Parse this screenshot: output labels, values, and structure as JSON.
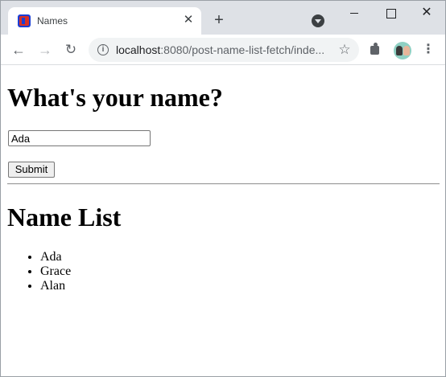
{
  "browser": {
    "tab_title": "Names",
    "tab_close": "✕",
    "new_tab": "+",
    "url_host": "localhost",
    "url_rest": ":8080/post-name-list-fetch/inde...",
    "icons": {
      "favicon": "app-favicon",
      "back": "arrow-left-icon",
      "forward": "arrow-right-icon",
      "reload": "reload-icon",
      "info": "info-icon",
      "star": "star-icon",
      "extensions": "puzzle-icon",
      "profile": "avatar",
      "menu": "kebab-menu-icon"
    },
    "window_close": "✕"
  },
  "page": {
    "heading": "What's your name?",
    "name_input_value": "Ada",
    "submit_label": "Submit",
    "list_heading": "Name List",
    "names": [
      "Ada",
      "Grace",
      "Alan"
    ]
  }
}
